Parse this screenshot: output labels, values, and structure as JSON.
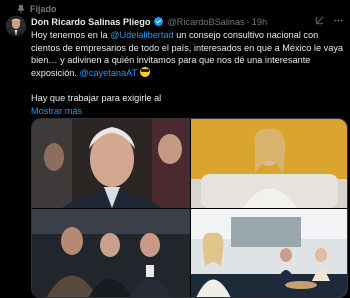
{
  "pinned": {
    "label": "Fijado",
    "icon": "pin-icon"
  },
  "tweet": {
    "author_name": "Don Ricardo Salinas Pliego",
    "handle": "@RicardoBSalinas",
    "separator": "·",
    "time": "19h",
    "text_1": "Hoy tenemos en la ",
    "mention_1": "@Udelalibertad",
    "text_2": " un consejo consultivo nacional con cientos de empresarios de todo el país, interesados en que a México le vaya bien… y adivinen a quién invitamos para que nos dé una interesante exposición. ",
    "mention_2": "@cayetanaAT",
    "text_3": "Hay que trabajar para exigirle al",
    "show_more": "Mostrar más"
  },
  "icons": {
    "verified": "verified-badge-icon",
    "grok": "grok-icon",
    "more": "more-options-icon",
    "emoji": "sunglasses-emoji-icon"
  },
  "colors": {
    "accent": "#1d9bf0",
    "muted": "#71767b",
    "text": "#e7e9ea",
    "background": "#000000"
  }
}
